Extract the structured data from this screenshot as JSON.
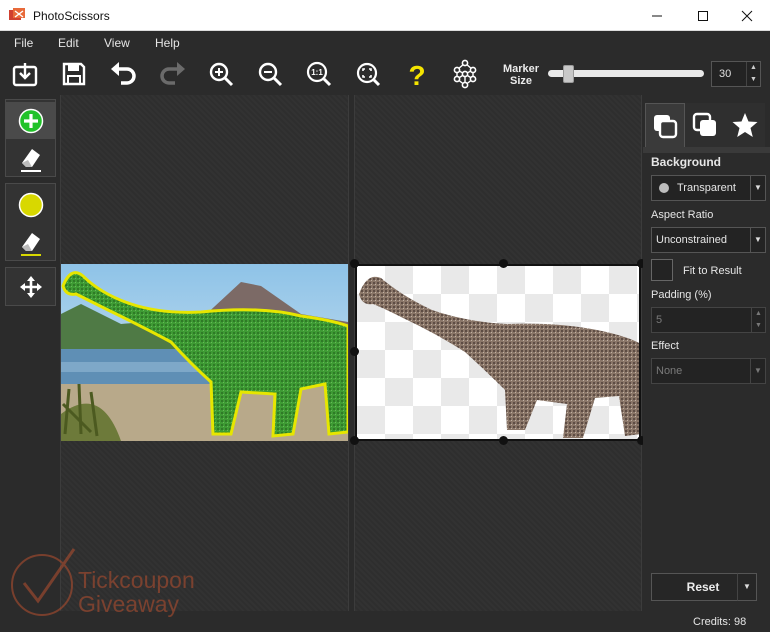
{
  "window": {
    "title": "PhotoScissors"
  },
  "menu": [
    "File",
    "Edit",
    "View",
    "Help"
  ],
  "toolbar": {
    "icons": [
      "open-icon",
      "save-icon",
      "undo-icon",
      "redo-icon",
      "zoom-in-icon",
      "zoom-out-icon",
      "zoom-actual-icon",
      "zoom-fit-icon",
      "help-icon",
      "network-icon"
    ],
    "marker_label": "Marker Size",
    "marker_value": "30",
    "marker_fraction": 0.13
  },
  "panel": {
    "background_label": "Background",
    "background_value": "Transparent",
    "aspect_label": "Aspect Ratio",
    "aspect_value": "Unconstrained",
    "fit_label": "Fit to Result",
    "padding_label": "Padding (%)",
    "padding_value": "5",
    "effect_label": "Effect",
    "effect_value": "None",
    "reset_label": "Reset",
    "credits": "Credits: 98"
  },
  "watermark": {
    "line1": "Tickcoupon",
    "line2": "Giveaway"
  },
  "colors": {
    "keep_marker": "#22c22a",
    "bg_marker": "#d8d800",
    "help": "#f4e400"
  }
}
